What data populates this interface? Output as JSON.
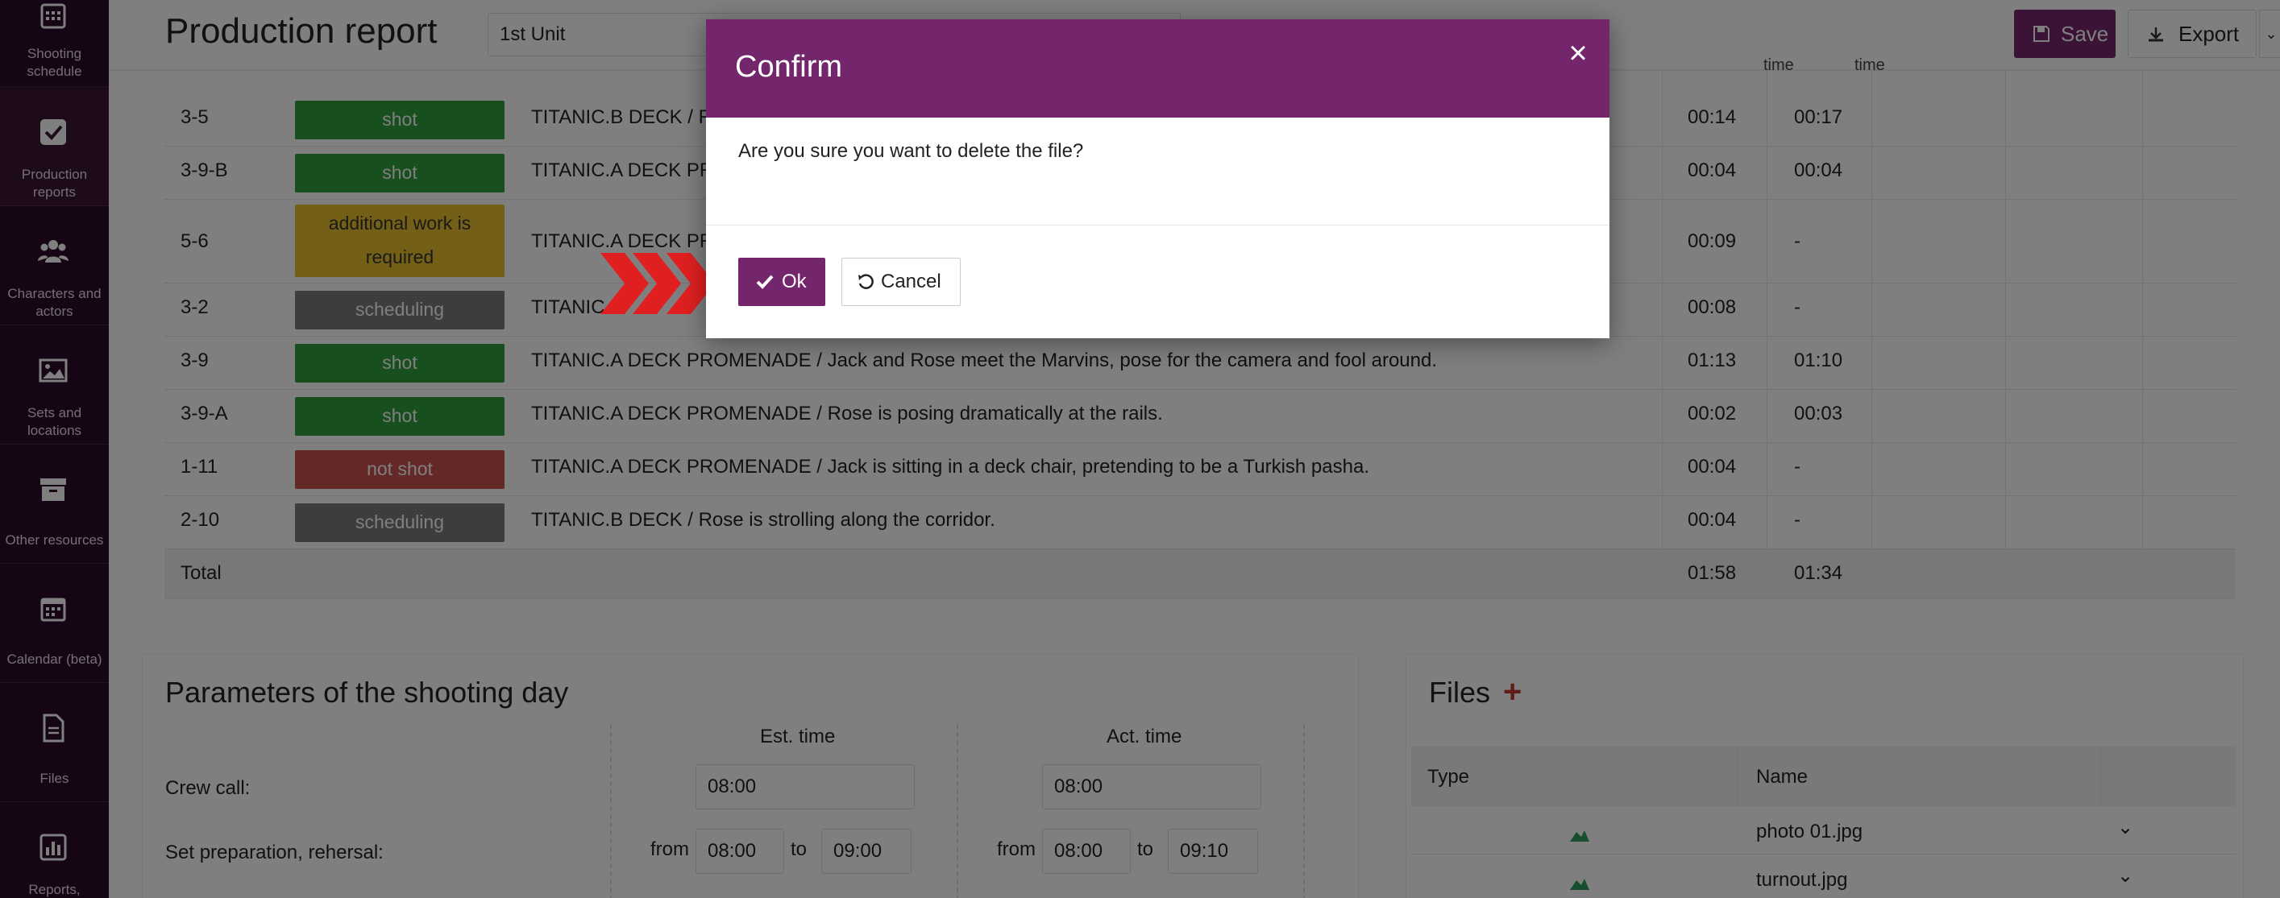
{
  "sidebar": {
    "items": [
      {
        "label_1": "Shooting",
        "label_2": "schedule",
        "icon": "calendar-grid-icon"
      },
      {
        "label_1": "Production",
        "label_2": "reports",
        "icon": "checkbox-icon"
      },
      {
        "label_1": "Characters and",
        "label_2": "actors",
        "icon": "people-icon"
      },
      {
        "label_1": "Sets and",
        "label_2": "locations",
        "icon": "image-icon"
      },
      {
        "label_1": "Other resources",
        "label_2": "",
        "icon": "archive-box-icon"
      },
      {
        "label_1": "Calendar (beta)",
        "label_2": "",
        "icon": "calendar-icon"
      },
      {
        "label_1": "Files",
        "label_2": "",
        "icon": "file-icon"
      },
      {
        "label_1": "Reports,",
        "label_2": "",
        "icon": "bar-chart-icon"
      }
    ]
  },
  "header": {
    "title": "Production report",
    "unit": "1st Unit",
    "save_label": "Save",
    "export_label": "Export",
    "col_est_partial": "time",
    "col_act_partial": "time"
  },
  "scenes": [
    {
      "num": "3-5",
      "status": "shot",
      "status_kind": "shot",
      "desc": "TITANIC.B DECK / Re",
      "est": "00:14",
      "act": "00:17"
    },
    {
      "num": "3-9-B",
      "status": "shot",
      "status_kind": "shot",
      "desc": "TITANIC.A DECK PRO",
      "est": "00:04",
      "act": "00:04"
    },
    {
      "num": "5-6",
      "status": "additional work is required",
      "status_kind": "additional",
      "desc": "TITANIC.A DECK PRO",
      "est": "00:09",
      "act": "-"
    },
    {
      "num": "3-2",
      "status": "scheduling",
      "status_kind": "scheduling",
      "desc": "TITANIC.A",
      "est": "00:08",
      "act": "-"
    },
    {
      "num": "3-9",
      "status": "shot",
      "status_kind": "shot",
      "desc": "TITANIC.A DECK PROMENADE / Jack and Rose meet the Marvins, pose for the camera and fool around.",
      "est": "01:13",
      "act": "01:10"
    },
    {
      "num": "3-9-A",
      "status": "shot",
      "status_kind": "shot",
      "desc": "TITANIC.A DECK PROMENADE / Rose is posing dramatically at the rails.",
      "est": "00:02",
      "act": "00:03"
    },
    {
      "num": "1-11",
      "status": "not shot",
      "status_kind": "not-shot",
      "desc": "TITANIC.A DECK PROMENADE / Jack is sitting in a deck chair, pretending to be a Turkish pasha.",
      "est": "00:04",
      "act": "-"
    },
    {
      "num": "2-10",
      "status": "scheduling",
      "status_kind": "scheduling",
      "desc": "TITANIC.B DECK / Rose is strolling along the corridor.",
      "est": "00:04",
      "act": "-"
    }
  ],
  "total": {
    "label": "Total",
    "est": "01:58",
    "act": "01:34"
  },
  "params": {
    "title": "Parameters of the shooting day",
    "est_head": "Est. time",
    "act_head": "Act. time",
    "crew_call_label": "Crew call:",
    "crew_call_est": "08:00",
    "crew_call_act": "08:00",
    "set_prep_label": "Set preparation, rehersal:",
    "from_word": "from",
    "to_word": "to",
    "set_prep_est_from": "08:00",
    "set_prep_est_to": "09:00",
    "set_prep_act_from": "08:00",
    "set_prep_act_to": "09:10"
  },
  "files": {
    "title": "Files",
    "add_icon": "plus-icon",
    "col_type": "Type",
    "col_name": "Name",
    "items": [
      {
        "name": "photo 01.jpg",
        "icon": "image-file-icon"
      },
      {
        "name": "turnout.jpg",
        "icon": "image-file-icon"
      }
    ]
  },
  "modal": {
    "title": "Confirm",
    "message": "Are you sure you want to delete the file?",
    "ok_label": "Ok",
    "cancel_label": "Cancel"
  },
  "colors": {
    "brand": "#74266c",
    "sidebar": "#2c0d2a",
    "shot": "#2e9e3e",
    "additional": "#e6c12c",
    "scheduling": "#7a7a7a",
    "not_shot": "#c9534f",
    "pointer": "#e02020"
  }
}
